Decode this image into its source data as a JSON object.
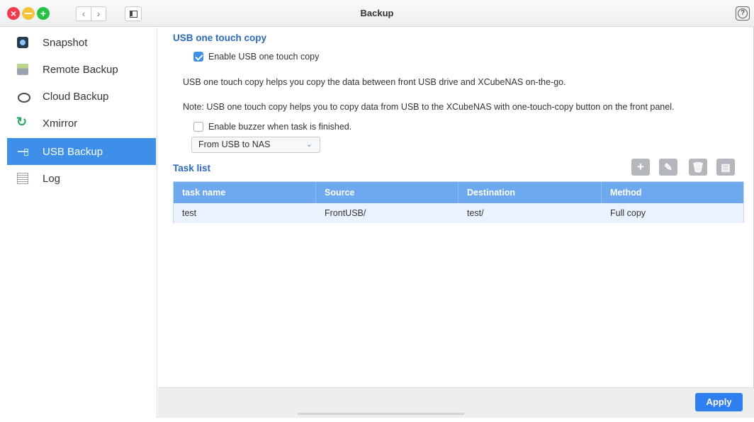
{
  "window": {
    "title": "Backup"
  },
  "sidebar": {
    "items": [
      {
        "label": "Snapshot",
        "icon": "camera-icon"
      },
      {
        "label": "Remote Backup",
        "icon": "remote-backup-icon"
      },
      {
        "label": "Cloud Backup",
        "icon": "cloud-icon"
      },
      {
        "label": "Xmirror",
        "icon": "sync-icon"
      },
      {
        "label": "USB Backup",
        "icon": "usb-icon",
        "active": true
      },
      {
        "label": "Log",
        "icon": "log-icon"
      }
    ]
  },
  "usb_copy": {
    "section_title": "USB one touch copy",
    "enable_label": "Enable USB one touch copy",
    "enable_checked": true,
    "description": "USB one touch copy helps you copy the data between front USB drive and XCubeNAS on-the-go.",
    "note": "Note: USB one touch copy helps you to copy data from USB to the XCubeNAS with one-touch-copy button on the front panel.",
    "buzzer_label": "Enable buzzer when task is finished.",
    "buzzer_checked": false,
    "direction_selected": "From USB to NAS"
  },
  "task_list": {
    "title": "Task list",
    "columns": [
      "task name",
      "Source",
      "Destination",
      "Method"
    ],
    "rows": [
      [
        "test",
        "FrontUSB/",
        "test/",
        "Full copy"
      ]
    ]
  },
  "footer": {
    "apply_label": "Apply"
  },
  "colors": {
    "accent": "#3d8fe8",
    "header": "#6ea8ef",
    "section_title": "#2b69b9"
  }
}
